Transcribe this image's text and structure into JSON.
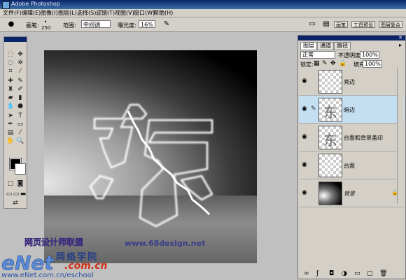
{
  "titlebar": {
    "title": "Adobe Photoshop"
  },
  "menu": [
    "文件(F)",
    "编辑(E)",
    "图像(I)",
    "图层(L)",
    "选择(S)",
    "滤镜(T)",
    "视图(V)",
    "窗口(W)",
    "帮助(H)"
  ],
  "options": {
    "brush_label": "画笔:",
    "brush_size": "250",
    "range_label": "范围:",
    "range_value": "中间调",
    "exposure_label": "曝光度:",
    "exposure_value": "16%",
    "tabs": [
      "画笔",
      "工具预设",
      "图层复合"
    ]
  },
  "canvas": {
    "glyph": "东"
  },
  "watermark": {
    "line1": "网页设计师联盟",
    "line2": "www.68design.net",
    "logo": "eNet",
    "logo_cn": "网络学院",
    "logo_com": ".com.cn",
    "url": "www.eNet.com.cn/eschool"
  },
  "layers_panel": {
    "tabs": [
      "图层",
      "通道",
      "路径"
    ],
    "blend_mode": "正常",
    "opacity_label": "不透明度:",
    "opacity_value": "100%",
    "lock_label": "锁定:",
    "fill_label": "填充:",
    "fill_value": "100%",
    "layers": [
      {
        "name": "亮边"
      },
      {
        "name": "暗边"
      },
      {
        "name": "台面和背景盖印"
      },
      {
        "name": "台面"
      },
      {
        "name": "背景"
      }
    ]
  },
  "colors": {
    "selected_layer": "#c4dff2",
    "titlebar": "#0a246a"
  }
}
